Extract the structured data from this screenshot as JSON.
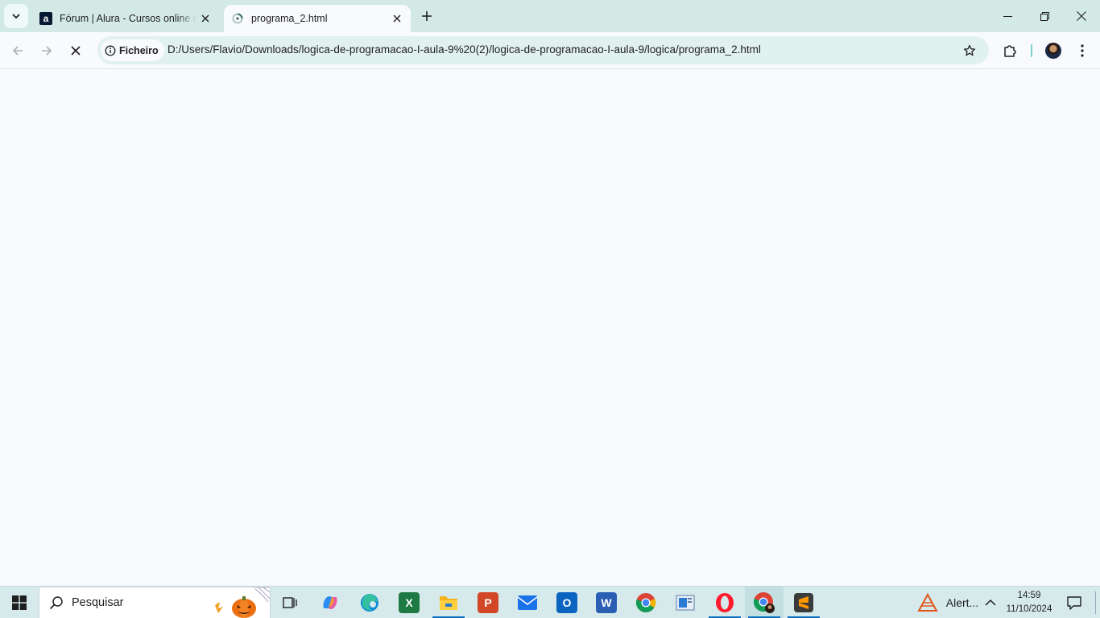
{
  "browser": {
    "tabs": [
      {
        "title": "Fórum | Alura - Cursos online de tecnologia",
        "favicon": "alura-icon",
        "active": false
      },
      {
        "title": "programa_2.html",
        "favicon": "loading-spinner-icon",
        "active": true
      }
    ],
    "new_tab_icon": "plus-icon",
    "address_bar": {
      "chip_label": "Ficheiro",
      "url": "D:/Users/Flavio/Downloads/logica-de-programacao-I-aula-9%20(2)/logica-de-programacao-I-aula-9/logica/programa_2.html"
    }
  },
  "taskbar": {
    "search_placeholder": "Pesquisar",
    "apps": [
      "task-view-icon",
      "copilot-icon",
      "edge-icon",
      "excel-icon",
      "file-explorer-icon",
      "powerpoint-icon",
      "mail-icon",
      "outlook-icon",
      "word-icon",
      "chrome-icon",
      "app-icon",
      "opera-icon",
      "chrome-profile-icon",
      "sublime-text-icon"
    ],
    "alert_label": "Alert...",
    "clock": {
      "time": "14:59",
      "date": "11/10/2024"
    }
  },
  "colors": {
    "tabstrip": "#d3e9e6",
    "omnibox": "#e1f1ef",
    "page": "#f8fafd",
    "taskbar": "#d6eaec",
    "running_indicator": "#0a6dc2"
  }
}
